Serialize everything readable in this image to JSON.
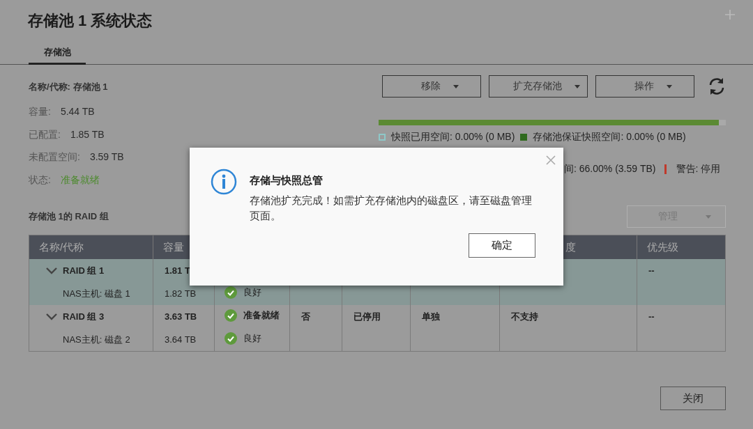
{
  "window": {
    "title": "存储池 1 系统状态"
  },
  "tabs": [
    {
      "label": "存储池",
      "selected": true
    }
  ],
  "info": {
    "name": "名称/代称: 存储池 1",
    "fields": [
      {
        "label": "容量:",
        "value": "5.44 TB",
        "kind": "plain"
      },
      {
        "label": "已配置:",
        "value": "1.85 TB",
        "kind": "plain"
      },
      {
        "label": "未配置空间:",
        "value": "3.59 TB",
        "kind": "plain"
      },
      {
        "label": "状态:",
        "value": "准备就绪",
        "kind": "good"
      }
    ]
  },
  "actions": [
    {
      "label": "移除"
    },
    {
      "label": "扩充存储池"
    },
    {
      "label": "操作"
    }
  ],
  "usage": {
    "level": 0.98
  },
  "legend": [
    [
      {
        "kind": "outline",
        "color": "#8ec8c8",
        "text": "快照已用空间: 0.00% (0 MB)"
      },
      {
        "kind": "square",
        "color": "#2f6a1e",
        "text": "存储池保证快照空间: 0.00% (0 MB)"
      }
    ],
    [
      {
        "kind": "none",
        "text": "间: 66.00% (3.59 TB)"
      },
      {
        "kind": "bar",
        "color": "#c0392b",
        "text": "警告: 停用"
      }
    ]
  ],
  "raid_section": {
    "title": "存储池 1的 RAID 组",
    "manage": {
      "label": "管理",
      "disabled": true
    }
  },
  "table": {
    "columns": [
      {
        "label": "名称/代称"
      },
      {
        "label": "容量"
      },
      {},
      {},
      {},
      {},
      {
        "label": "度"
      },
      {
        "label": "优先级"
      }
    ],
    "groups": [
      {
        "name": "RAID 组 1",
        "expanded": true,
        "selected": true,
        "cells": [
          {
            "text": "1.81 T"
          },
          {},
          {},
          {},
          {},
          {},
          {
            "text": "--"
          }
        ],
        "children": [
          {
            "name": "NAS主机: 磁盘 1",
            "cells": [
              {
                "text": "1.82 TB"
              },
              {
                "text": "良好",
                "ok": true
              }
            ]
          }
        ]
      },
      {
        "name": "RAID 组 3",
        "expanded": true,
        "selected": false,
        "cells": [
          {
            "text": "3.63 TB"
          },
          {
            "text": "准备就绪",
            "ok": true
          },
          {
            "text": "否"
          },
          {
            "text": "已停用"
          },
          {
            "text": "单独"
          },
          {
            "text": "不支持"
          },
          {
            "text": "--"
          }
        ],
        "children": [
          {
            "name": "NAS主机: 磁盘 2",
            "cells": [
              {
                "text": "3.64 TB"
              },
              {
                "text": "良好",
                "ok": true
              }
            ]
          }
        ]
      }
    ]
  },
  "close_button": "关闭",
  "dialog": {
    "title": "存储与快照总管",
    "message": "存储池扩充完成！如需扩充存储池内的磁盘区，请至磁盘管理页面。",
    "ok": "确定"
  }
}
